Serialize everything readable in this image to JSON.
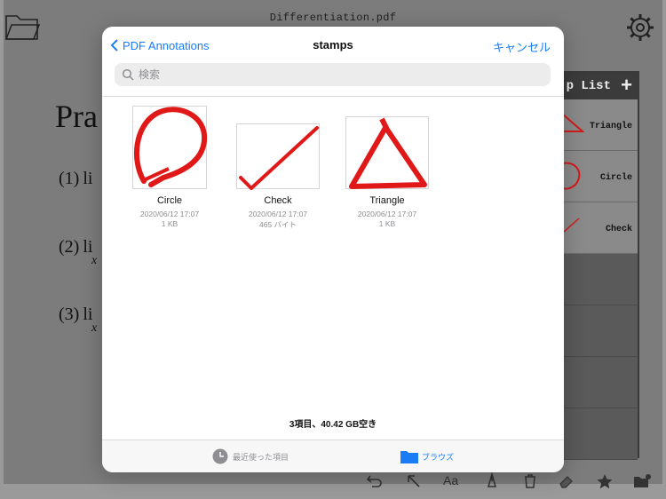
{
  "app": {
    "document_title": "Differentiation.pdf",
    "heading_partial": "Pra",
    "problems": [
      {
        "num": "(1)",
        "text": "li"
      },
      {
        "num": "(2)",
        "text": "li",
        "sub": "x"
      },
      {
        "num": "(3)",
        "text": "li",
        "sub": "x"
      }
    ],
    "stamp_panel": {
      "title": "p List",
      "add_symbol": "+",
      "items": [
        "Triangle",
        "Circle",
        "Check"
      ]
    },
    "toolbar_icons": [
      "undo-icon",
      "pointer-icon",
      "text-icon",
      "pen-icon",
      "trash-icon",
      "eraser-icon",
      "star-icon",
      "folder-settings-icon"
    ],
    "toolbar_text_label": "Aa"
  },
  "picker": {
    "back_label": "PDF Annotations",
    "title": "stamps",
    "cancel_label": "キャンセル",
    "search_placeholder": "検索",
    "files": [
      {
        "name": "Circle",
        "date": "2020/06/12 17:07",
        "size": "1 KB",
        "stroke": "#e01818"
      },
      {
        "name": "Check",
        "date": "2020/06/12 17:07",
        "size": "465 バイト",
        "stroke": "#e01818"
      },
      {
        "name": "Triangle",
        "date": "2020/06/12 17:07",
        "size": "1 KB",
        "stroke": "#e01818"
      }
    ],
    "storage_info": "3項目、40.42 GB空き",
    "tabs": {
      "recent_label": "最近使った項目",
      "browse_label": "ブラウズ"
    },
    "colors": {
      "accent": "#1a7cf5",
      "stamp_red": "#e01818"
    }
  }
}
